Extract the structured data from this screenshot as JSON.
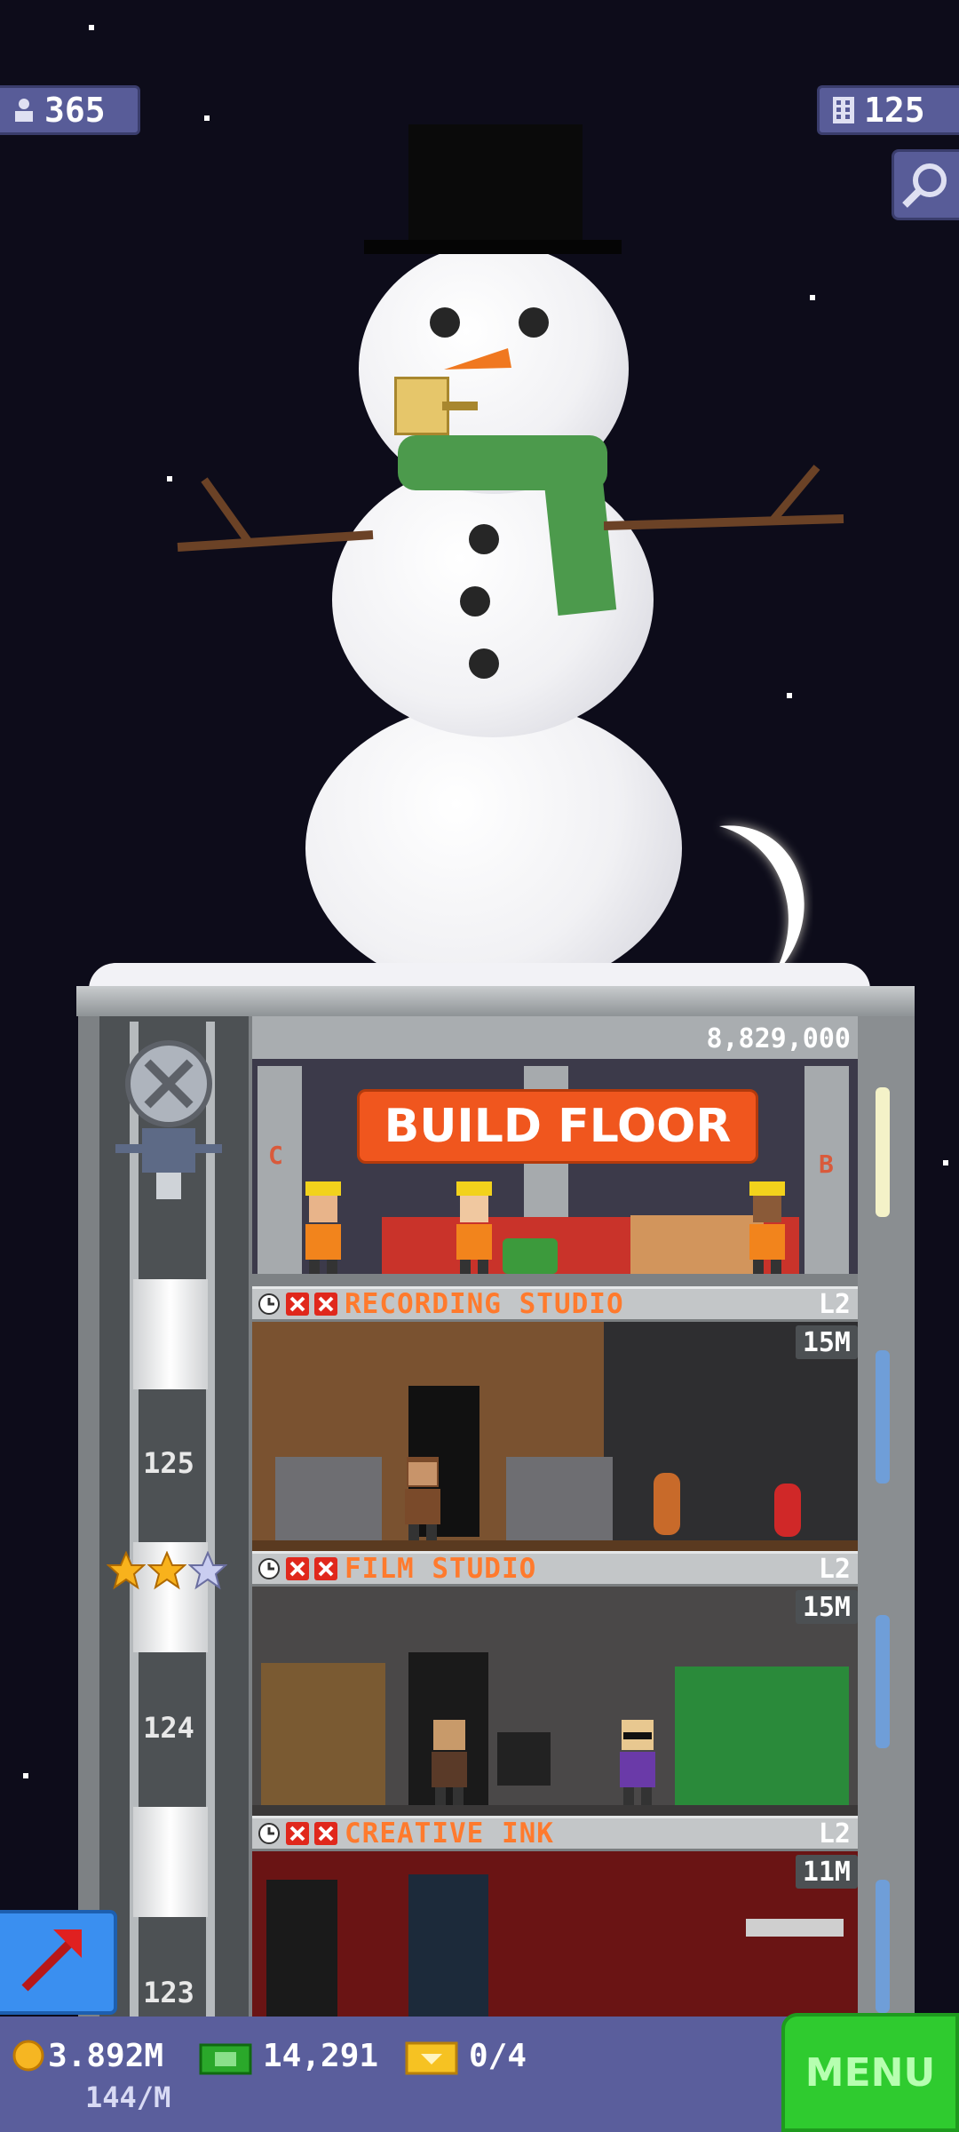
{
  "hud": {
    "population": "365",
    "floors": "125"
  },
  "build": {
    "cost": "8,829,000",
    "label": "BUILD FLOOR",
    "left_letter": "C",
    "right_letter": "B"
  },
  "floors": [
    {
      "name": "RECORDING STUDIO",
      "level": "L2",
      "price": "15M",
      "number": "125"
    },
    {
      "name": "FILM STUDIO",
      "level": "L2",
      "price": "15M",
      "number": "124"
    },
    {
      "name": "CREATIVE INK",
      "level": "L2",
      "price": "11M",
      "number": "123"
    }
  ],
  "stars": {
    "filled": 2,
    "total": 3
  },
  "bottom": {
    "coins": "3.892M",
    "coin_rate": "144/M",
    "bux": "14,291",
    "tickets": "0/4",
    "menu_label": "MENU"
  },
  "colors": {
    "sky": "#0d0c1a",
    "hud": "#585c98",
    "build_button": "#f0561e",
    "floor_name": "#ff7a2d",
    "menu": "#2fcb2f",
    "elevator_button": "#3a8ff0"
  },
  "icons": [
    "person-icon",
    "building-icon",
    "search-icon",
    "clock-icon",
    "x-icon",
    "star-icon",
    "coin-icon",
    "bux-icon",
    "ticket-icon",
    "arrow-icon"
  ]
}
